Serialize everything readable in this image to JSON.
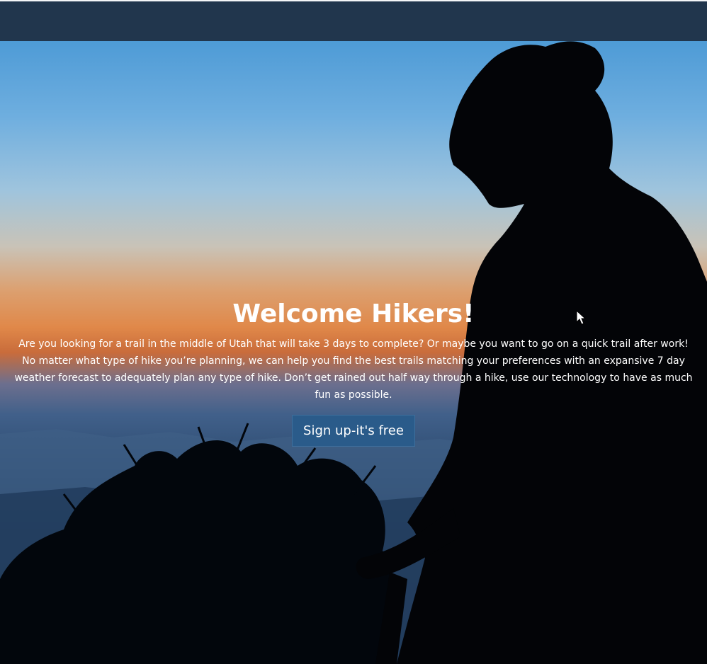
{
  "hero": {
    "title": "Welcome Hikers!",
    "description": "Are you looking for a trail in the middle of Utah that will take 3 days to complete? Or maybe you want to go on a quick trail after work! No matter what type of hike you’re planning, we can help you find the best trails matching your preferences with an expansive 7 day weather forecast to adequately plan any type of hike. Don’t get rained out half way through a hike, use our technology to have as much fun as possible.",
    "cta_label": "Sign up-it's free"
  },
  "colors": {
    "navbar": "#21364d",
    "button": "#2a5b8a",
    "text": "#ffffff"
  },
  "icons": {
    "cursor": "arrow-cursor-icon"
  }
}
